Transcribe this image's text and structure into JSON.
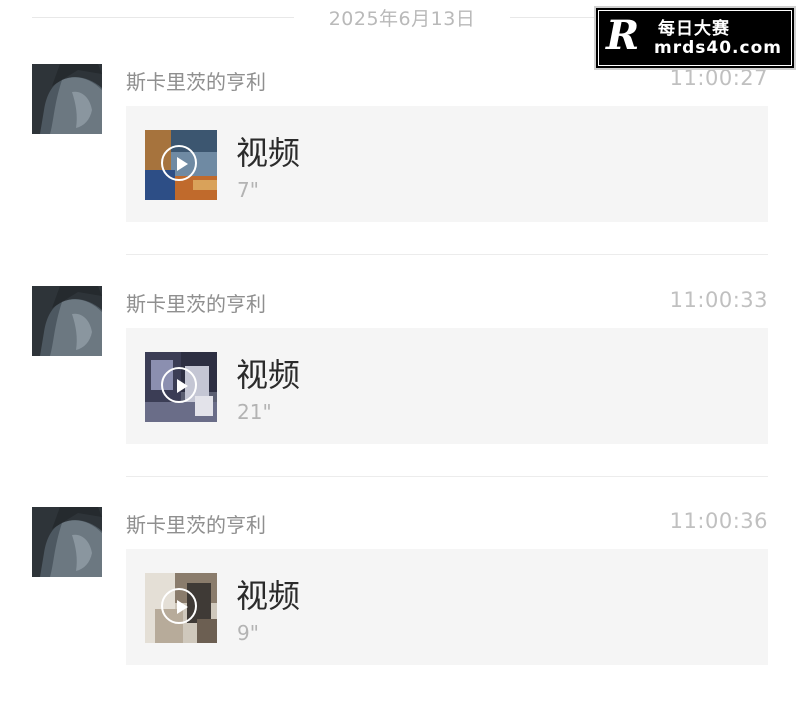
{
  "date_separator": "2025年6月13日",
  "messages": [
    {
      "sender": "斯卡里茨的亨利",
      "time": "11:00:27",
      "card_title": "视频",
      "duration": "7\""
    },
    {
      "sender": "斯卡里茨的亨利",
      "time": "11:00:33",
      "card_title": "视频",
      "duration": "21\""
    },
    {
      "sender": "斯卡里茨的亨利",
      "time": "11:00:36",
      "card_title": "视频",
      "duration": "9\""
    }
  ],
  "icons": {
    "avatar": "user-avatar",
    "play": "play-icon"
  },
  "colors": {
    "card_bg": "#f5f5f5",
    "sender_text": "#8f8f8f",
    "time_text": "#c0c0c0",
    "title_text": "#2b2b2b"
  },
  "watermark": {
    "logo_letter": "R",
    "name": "每日大赛",
    "url": "mrds40.com"
  }
}
